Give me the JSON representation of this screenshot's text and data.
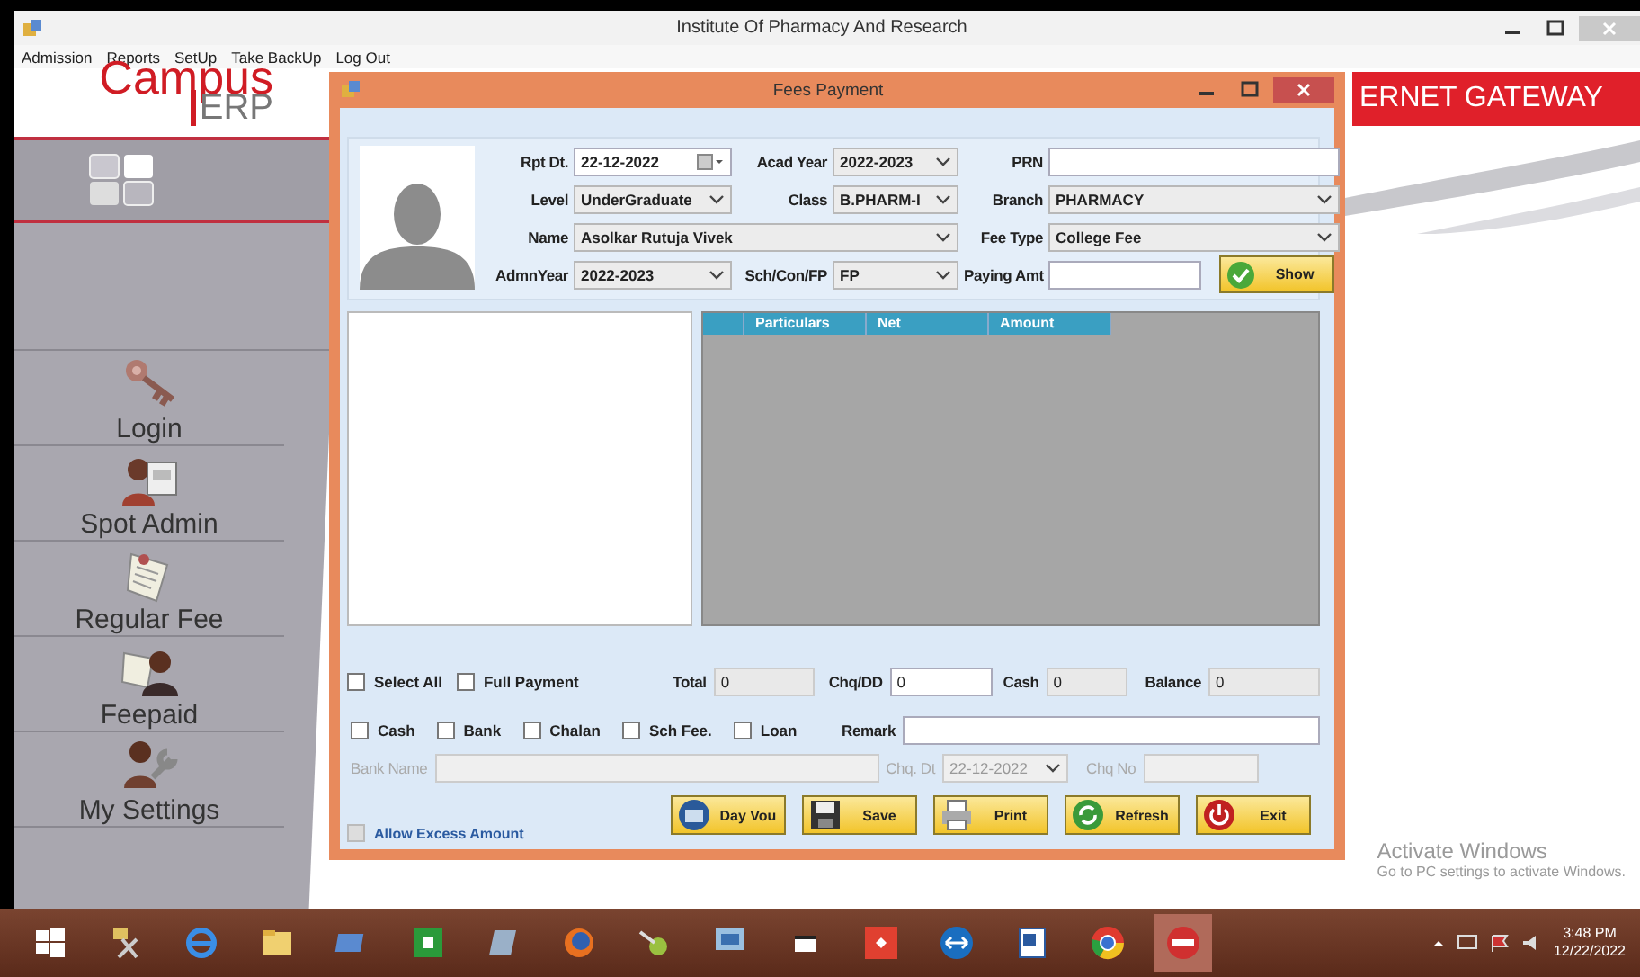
{
  "app_window": {
    "title": "Institute Of Pharmacy And Research",
    "menu": [
      "Admission",
      "Reports",
      "SetUp",
      "Take BackUp",
      "Log Out"
    ]
  },
  "logo": {
    "line_1": "Campus",
    "line_2": "ERP"
  },
  "banner": {
    "text": "ERNET GATEWAY"
  },
  "sidebar": {
    "items": [
      {
        "label": "Login",
        "kind": "key"
      },
      {
        "label": "Spot Admin",
        "kind": "admin"
      },
      {
        "label": "Regular Fee",
        "kind": "fee"
      },
      {
        "label": "Feepaid",
        "kind": "paid"
      },
      {
        "label": "My Settings",
        "kind": "settings"
      }
    ]
  },
  "dialog": {
    "title": "Fees Payment",
    "form_rows": [
      [
        {
          "label": "Rpt Dt.",
          "kind": "date",
          "value": "22-12-2022"
        },
        {
          "label": "Acad Year",
          "kind": "combo",
          "value": "2022-2023"
        },
        {
          "label": "PRN",
          "kind": "text"
        }
      ],
      [
        {
          "label": "Level",
          "kind": "combo",
          "value": "UnderGraduate"
        },
        {
          "label": "Class",
          "kind": "combo",
          "value": "B.PHARM-I"
        },
        {
          "label": "Branch",
          "kind": "combo",
          "value": "PHARMACY"
        }
      ],
      [
        {
          "label": "Name",
          "kind": "combo",
          "value": "Asolkar Rutuja Vivek"
        },
        {
          "label": "Fee Type",
          "kind": "combo",
          "value": "College Fee"
        }
      ],
      [
        {
          "label": "AdmnYear",
          "kind": "combo",
          "value": "2022-2023"
        },
        {
          "label": "Sch/Con/FP",
          "kind": "combo",
          "value": "FP"
        },
        {
          "label": "Paying Amt",
          "kind": "text"
        }
      ]
    ],
    "show_button": {
      "label": "Show"
    },
    "grid": {
      "columns": [
        "Particulars",
        "Net",
        "Amount"
      ]
    },
    "select_row": [
      {
        "label": "Select All",
        "checked": false
      },
      {
        "label": "Full Payment",
        "checked": false
      }
    ],
    "amounts": [
      {
        "label": "Total",
        "value": "0",
        "readonly": true
      },
      {
        "label": "Chq/DD",
        "value": "0",
        "readonly": false
      },
      {
        "label": "Cash",
        "value": "0",
        "readonly": true
      },
      {
        "label": "Balance",
        "value": "0",
        "readonly": true
      }
    ],
    "payment_modes": [
      {
        "label": "Cash",
        "checked": false
      },
      {
        "label": "Bank",
        "checked": false
      },
      {
        "label": "Chalan",
        "checked": false
      },
      {
        "label": "Sch Fee.",
        "checked": false
      },
      {
        "label": "Loan",
        "checked": false
      }
    ],
    "remark": {
      "label": "Remark"
    },
    "cheque_row": [
      {
        "label": "Bank Name",
        "kind": "text",
        "disabled": true
      },
      {
        "label": "Chq. Dt",
        "kind": "combo",
        "value": "22-12-2022",
        "disabled": true
      },
      {
        "label": "Chq No",
        "kind": "text",
        "disabled": true
      }
    ],
    "allow_excess": {
      "label": "Allow Excess Amount",
      "checked": false,
      "disabled": true
    },
    "buttons": [
      {
        "label": "Day Vou",
        "kind": "voucher"
      },
      {
        "label": "Save",
        "kind": "save"
      },
      {
        "label": "Print",
        "kind": "print"
      },
      {
        "label": "Refresh",
        "kind": "refresh"
      },
      {
        "label": "Exit",
        "kind": "exit"
      }
    ]
  },
  "activation_notice": {
    "title": "Activate Windows",
    "text": "Go to PC settings to activate Windows."
  },
  "taskbar": {
    "time": "3:48 PM",
    "date": "12/22/2022"
  }
}
